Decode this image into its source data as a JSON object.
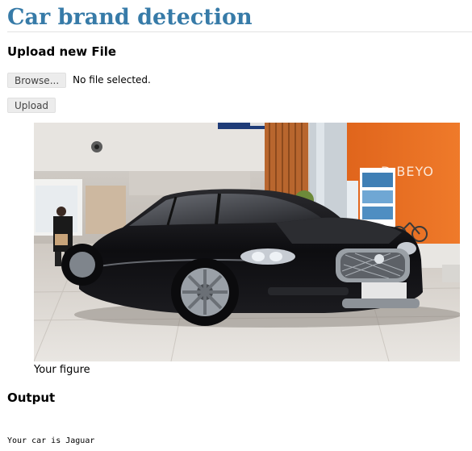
{
  "page": {
    "title": "Car brand detection"
  },
  "upload": {
    "heading": "Upload new File",
    "browse_label": "Browse...",
    "file_status": "No file selected.",
    "submit_label": "Upload"
  },
  "figure": {
    "caption": "Your figure",
    "background_sign_text": "D BEYO"
  },
  "output": {
    "heading": "Output",
    "result": "Your car is Jaguar"
  },
  "colors": {
    "title": "#377ba8",
    "rule": "#e2e2e2",
    "button_bg": "#ececec"
  }
}
